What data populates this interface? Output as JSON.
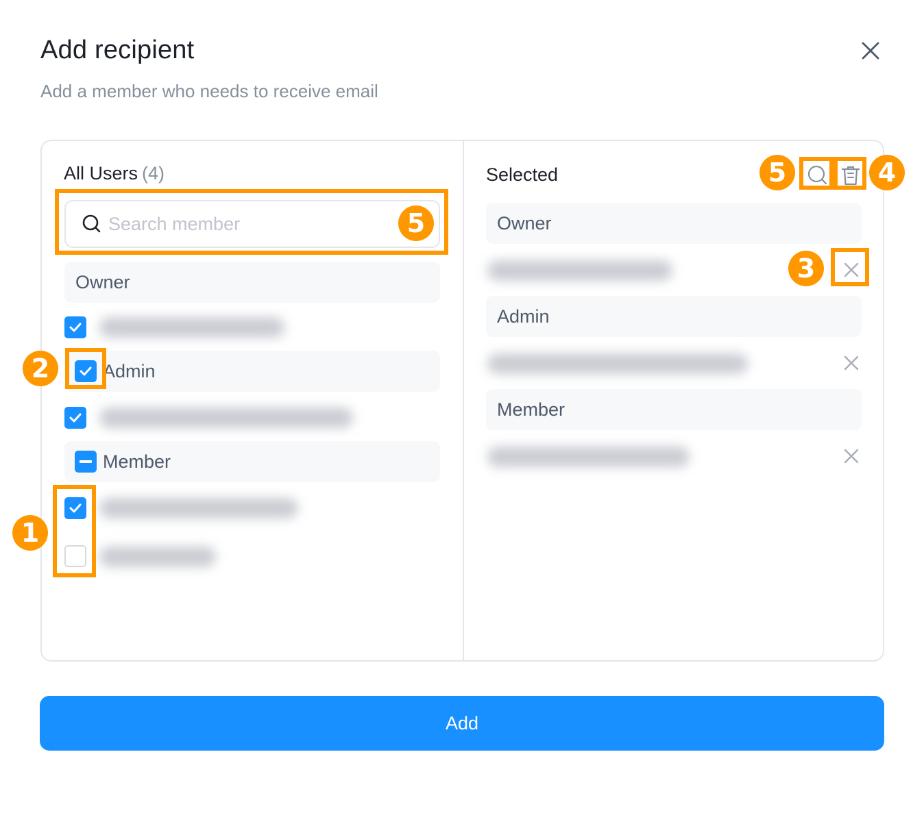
{
  "dialog": {
    "title": "Add recipient",
    "subtitle": "Add a member who needs to receive email"
  },
  "left_panel": {
    "title": "All Users",
    "count": "(4)",
    "search_placeholder": "Search member",
    "groups": {
      "owner": {
        "label": "Owner"
      },
      "admin": {
        "label": "Admin",
        "state": "checked"
      },
      "member": {
        "label": "Member",
        "state": "indeterminate"
      }
    },
    "users": [
      {
        "group": "Owner",
        "state": "checked",
        "blurred": true
      },
      {
        "group": "Admin",
        "state": "checked",
        "blurred": true
      },
      {
        "group": "Member",
        "state": "checked",
        "blurred": true
      },
      {
        "group": "Member",
        "state": "unchecked",
        "blurred": true
      }
    ]
  },
  "right_panel": {
    "title": "Selected",
    "groups": {
      "owner": {
        "label": "Owner"
      },
      "admin": {
        "label": "Admin"
      },
      "member": {
        "label": "Member"
      }
    }
  },
  "actions": {
    "add_label": "Add"
  },
  "annotations": {
    "badge_1": "1",
    "badge_2": "2",
    "badge_3": "3",
    "badge_4": "4",
    "badge_5a": "5",
    "badge_5b": "5"
  },
  "colors": {
    "primary": "#1890ff",
    "annotation": "#ff9800",
    "group_bg": "#f7f8fa",
    "border": "#e5e6eb",
    "muted_text": "#86909c"
  }
}
